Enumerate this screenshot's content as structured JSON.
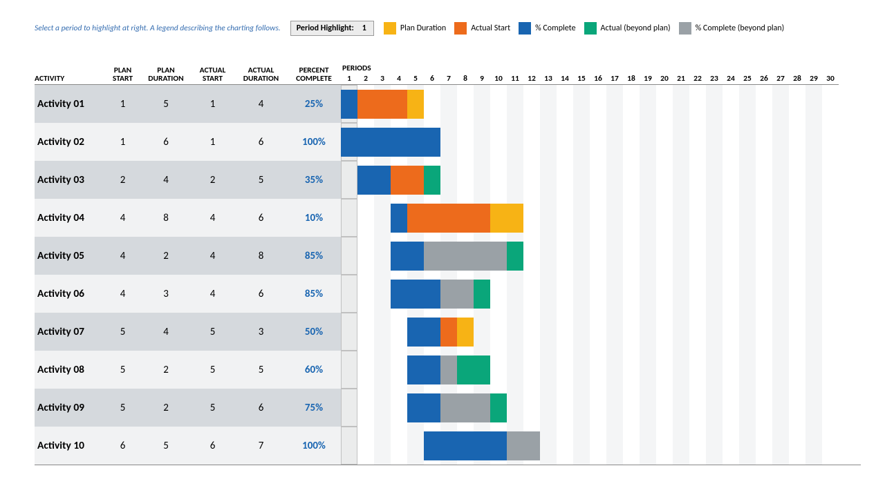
{
  "hint_text": "Select a period to highlight at right.  A legend describing the charting follows.",
  "period_highlight": {
    "label": "Period Highlight:",
    "value": "1"
  },
  "legend": [
    {
      "key": "plan",
      "label": "Plan Duration",
      "swatchClass": "c-plan"
    },
    {
      "key": "actual",
      "label": "Actual Start",
      "swatchClass": "c-actual"
    },
    {
      "key": "pct",
      "label": "% Complete",
      "swatchClass": "c-pct"
    },
    {
      "key": "beyond",
      "label": "Actual (beyond plan)",
      "swatchClass": "c-beyond"
    },
    {
      "key": "pcbey",
      "label": "% Complete (beyond plan)",
      "swatchClass": "c-pcbey"
    }
  ],
  "headers": {
    "activity": "ACTIVITY",
    "plan_start": "PLAN START",
    "plan_dur": "PLAN DURATION",
    "act_start": "ACTUAL START",
    "act_dur": "ACTUAL DURATION",
    "pct": "PERCENT COMPLETE",
    "periods": "PERIODS"
  },
  "periods_count": 30,
  "highlight_period": 1,
  "activities": [
    {
      "name": "Activity 01",
      "planStart": 1,
      "planDur": 5,
      "actStart": 1,
      "actDur": 4,
      "pct": 25
    },
    {
      "name": "Activity 02",
      "planStart": 1,
      "planDur": 6,
      "actStart": 1,
      "actDur": 6,
      "pct": 100
    },
    {
      "name": "Activity 03",
      "planStart": 2,
      "planDur": 4,
      "actStart": 2,
      "actDur": 5,
      "pct": 35
    },
    {
      "name": "Activity 04",
      "planStart": 4,
      "planDur": 8,
      "actStart": 4,
      "actDur": 6,
      "pct": 10
    },
    {
      "name": "Activity 05",
      "planStart": 4,
      "planDur": 2,
      "actStart": 4,
      "actDur": 8,
      "pct": 85
    },
    {
      "name": "Activity 06",
      "planStart": 4,
      "planDur": 3,
      "actStart": 4,
      "actDur": 6,
      "pct": 85
    },
    {
      "name": "Activity 07",
      "planStart": 5,
      "planDur": 4,
      "actStart": 5,
      "actDur": 3,
      "pct": 50
    },
    {
      "name": "Activity 08",
      "planStart": 5,
      "planDur": 2,
      "actStart": 5,
      "actDur": 5,
      "pct": 60
    },
    {
      "name": "Activity 09",
      "planStart": 5,
      "planDur": 2,
      "actStart": 5,
      "actDur": 6,
      "pct": 75
    },
    {
      "name": "Activity 10",
      "planStart": 6,
      "planDur": 5,
      "actStart": 6,
      "actDur": 7,
      "pct": 100
    }
  ],
  "chart_data": {
    "type": "bar",
    "title": "",
    "xlabel": "PERIODS",
    "ylabel": "ACTIVITY",
    "xlim": [
      1,
      30
    ],
    "categories": [
      "Activity 01",
      "Activity 02",
      "Activity 03",
      "Activity 04",
      "Activity 05",
      "Activity 06",
      "Activity 07",
      "Activity 08",
      "Activity 09",
      "Activity 10"
    ],
    "series": [
      {
        "name": "PLAN START",
        "values": [
          1,
          1,
          2,
          4,
          4,
          4,
          5,
          5,
          5,
          6
        ]
      },
      {
        "name": "PLAN DURATION",
        "values": [
          5,
          6,
          4,
          8,
          2,
          3,
          4,
          2,
          2,
          5
        ]
      },
      {
        "name": "ACTUAL START",
        "values": [
          1,
          1,
          2,
          4,
          4,
          4,
          5,
          5,
          5,
          6
        ]
      },
      {
        "name": "ACTUAL DURATION",
        "values": [
          4,
          6,
          5,
          6,
          8,
          6,
          3,
          5,
          6,
          7
        ]
      },
      {
        "name": "PERCENT COMPLETE",
        "values": [
          25,
          100,
          35,
          10,
          85,
          85,
          50,
          60,
          75,
          100
        ]
      }
    ],
    "legend": [
      "Plan Duration",
      "Actual Start",
      "% Complete",
      "Actual (beyond plan)",
      "% Complete (beyond plan)"
    ],
    "legend_colors": [
      "#f7b315",
      "#ed6b1c",
      "#1965b1",
      "#0aa67a",
      "#9aa1a6"
    ]
  }
}
